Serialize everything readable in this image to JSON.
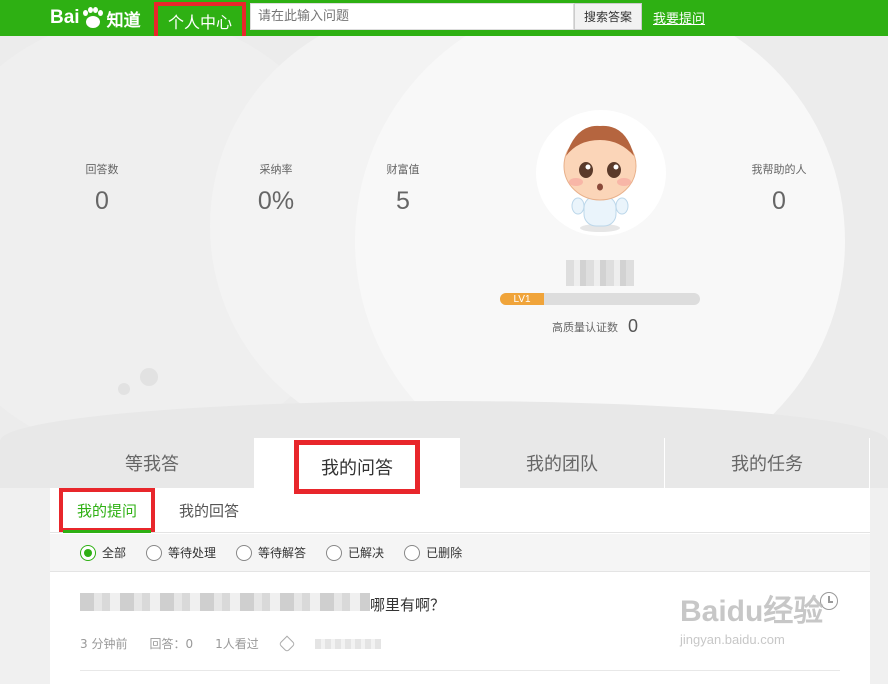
{
  "header": {
    "logo_text": "Bai",
    "logo_du": "du",
    "logo_product": "知道",
    "nav_home": "个人中心",
    "search_placeholder": "请在此输入问题",
    "search_button": "搜索答案",
    "ask_link": "我要提问"
  },
  "profile": {
    "stats": [
      {
        "label": "回答数",
        "value": "0"
      },
      {
        "label": "采纳率",
        "value": "0%"
      },
      {
        "label": "财富值",
        "value": "5"
      },
      {
        "label": "我帮助的人",
        "value": "0"
      }
    ],
    "level": {
      "label": "LV1",
      "progress": 0.22
    },
    "certification": {
      "label": "高质量认证数",
      "value": "0"
    }
  },
  "tabs": [
    {
      "label": "等我答"
    },
    {
      "label": "我的问答",
      "active": true
    },
    {
      "label": "我的团队"
    },
    {
      "label": "我的任务"
    }
  ],
  "subtabs": [
    {
      "label": "我的提问",
      "active": true
    },
    {
      "label": "我的回答"
    }
  ],
  "filters": [
    {
      "label": "全部",
      "checked": true
    },
    {
      "label": "等待处理"
    },
    {
      "label": "等待解答"
    },
    {
      "label": "已解决"
    },
    {
      "label": "已删除"
    }
  ],
  "question": {
    "title_visible": "哪里有啊？",
    "time": "3 分钟前",
    "answers": "回答：0",
    "views": "1人看过"
  },
  "watermark": {
    "main": "Baidu经验",
    "url": "jingyan.baidu.com"
  },
  "colors": {
    "brand_green": "#2eb013",
    "highlight_red": "#e8262b",
    "level_orange": "#f0a43a"
  }
}
